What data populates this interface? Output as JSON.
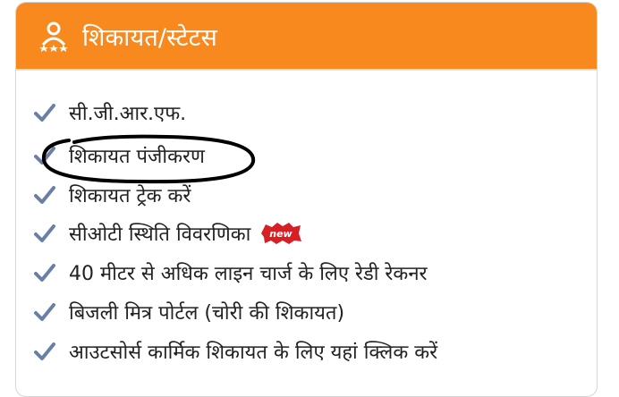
{
  "panel": {
    "title": "शिकायत/स्टेटस",
    "icon": "people-stars-icon"
  },
  "items": [
    {
      "label": "सी.जी.आर.एफ."
    },
    {
      "label": "शिकायत पंजीकरण"
    },
    {
      "label": "शिकायत ट्रेक करें"
    },
    {
      "label": "सीओटी स्थिति विवरणिका",
      "badge": "new"
    },
    {
      "label": "40 मीटर से अधिक लाइन चार्ज के लिए रेडी रेकनर"
    },
    {
      "label": "बिजली मित्र पोर्टल (चोरी की शिकायत)"
    },
    {
      "label": "आउटसोर्स कार्मिक शिकायत के लिए यहां क्लिक करें"
    }
  ],
  "colors": {
    "header": "#f7891e",
    "check": "#6a7fa6",
    "badge": "#d81f26"
  }
}
